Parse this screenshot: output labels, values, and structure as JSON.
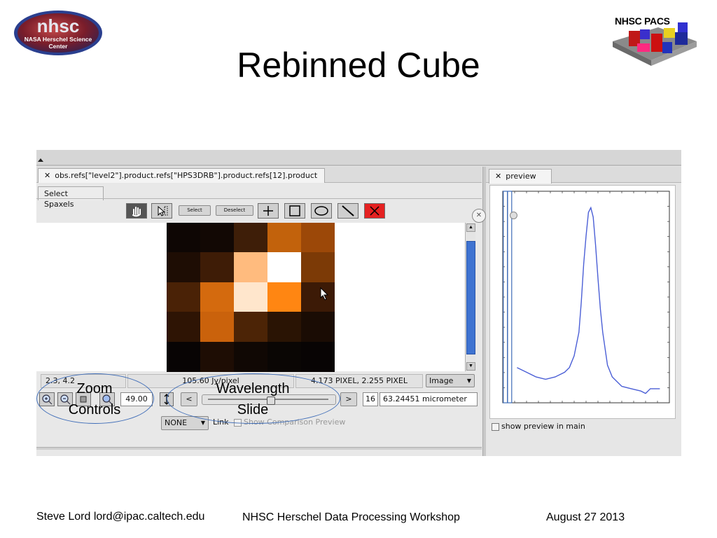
{
  "slide": {
    "title": "Rebinned Cube",
    "nhsc_logo_main": "nhsc",
    "nhsc_logo_sub1": "NASA Herschel Science",
    "nhsc_logo_sub2": "Center",
    "pacs_logo_text": "NHSC PACS"
  },
  "viewer": {
    "tab_label": "obs.refs[\"level2\"].product.refs[\"HPS3DRB\"].product.refs[12].product",
    "subtab_label": "Select Spaxels",
    "select_label": "Select",
    "deselect_label": "Deselect",
    "status": {
      "coords": "2.3, 4.2",
      "flux": "105.60 Jy/pixel",
      "pixel_pos": "4.173 PIXEL, 2.255 PIXEL",
      "mode": "Image"
    },
    "zoom_value": "49.00",
    "prev_label": "<",
    "next_label": ">",
    "slice_index": "16",
    "wavelength": "63.24451 micrometer",
    "link_select": "NONE",
    "link_label": "Link",
    "comparison_label": "Show Comparison Preview"
  },
  "preview": {
    "tab_label": "preview",
    "show_in_main_label": "show preview in main"
  },
  "annotations": {
    "zoom_line1": "Zoom",
    "zoom_line2": "Controls",
    "wave_line1": "Wavelength",
    "wave_line2": "Slide"
  },
  "footer": {
    "author": "Steve Lord lord@ipac.caltech.edu",
    "event": "NHSC Herschel Data Processing Workshop",
    "date": "August 27 2013"
  },
  "colors": {
    "accent_blue": "#3f6db8",
    "spectrum_line": "#4b5fd6",
    "delete_red": "#e52121"
  },
  "icons": [
    "hand-icon",
    "pointer-select-icon",
    "crosshair-icon",
    "rectangle-icon",
    "ellipse-icon",
    "line-icon",
    "delete-icon",
    "zoom-in-icon",
    "zoom-out-icon",
    "zoom-fit-icon",
    "zoom-icon",
    "close-icon",
    "dropdown-arrow-icon",
    "checkbox-icon"
  ],
  "spaxel_grid": [
    [
      "#0e0604",
      "#120804",
      "#3e1e08",
      "#c2620c",
      "#9c4808"
    ],
    [
      "#1e0d04",
      "#3e1c06",
      "#ffbb7e",
      "#ffffff",
      "#7c3a06"
    ],
    [
      "#4a2206",
      "#d46a0e",
      "#ffe6cc",
      "#ff8612",
      "#3c1a06"
    ],
    [
      "#2e1404",
      "#ca620c",
      "#4c2406",
      "#2a1404",
      "#1a0c04"
    ],
    [
      "#080404",
      "#1e0d04",
      "#100804",
      "#0a0604",
      "#080404"
    ]
  ],
  "chart_data": {
    "type": "line",
    "title": "",
    "xlabel": "",
    "ylabel": "",
    "x": [
      63.08,
      63.1,
      63.12,
      63.14,
      63.16,
      63.18,
      63.19,
      63.2,
      63.21,
      63.215,
      63.22,
      63.225,
      63.23,
      63.235,
      63.24,
      63.245,
      63.25,
      63.255,
      63.26,
      63.265,
      63.27,
      63.28,
      63.3,
      63.32,
      63.34,
      63.35,
      63.36,
      63.38
    ],
    "y": [
      30,
      28,
      26,
      25,
      26,
      28,
      30,
      35,
      45,
      58,
      74,
      86,
      96,
      98,
      94,
      82,
      68,
      55,
      45,
      38,
      31,
      26,
      22,
      21,
      20,
      19,
      21,
      21
    ],
    "xlim": [
      63.05,
      63.4
    ],
    "ylim": [
      15,
      105
    ],
    "cursor_x": 63.06
  }
}
